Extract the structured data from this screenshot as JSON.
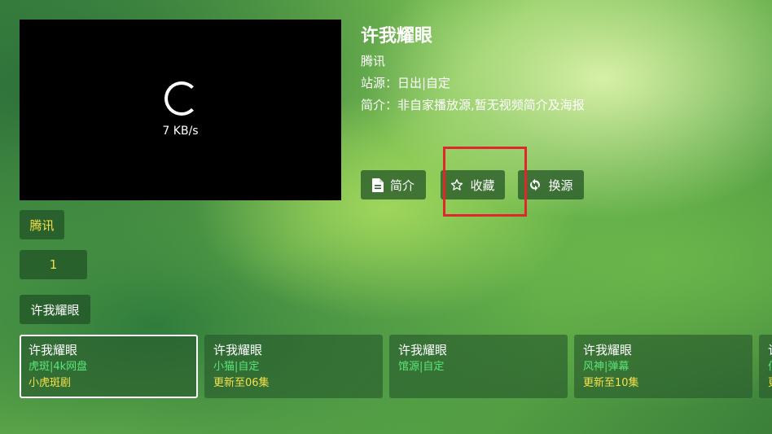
{
  "player": {
    "speed": "7 KB/s"
  },
  "info": {
    "title": "许我耀眼",
    "provider": "腾讯",
    "site": "站源：日出|自定",
    "intro": "简介：非自家播放源,暂无视频简介及海报"
  },
  "actions": {
    "intro_label": "简介",
    "fav_label": "收藏",
    "switch_label": "换源"
  },
  "left": {
    "source_tab": "腾讯",
    "episode": "1",
    "search_name": "许我耀眼"
  },
  "cards": [
    {
      "title": "许我耀眼",
      "source": "虎斑|4k网盘",
      "update": "小虎斑剧"
    },
    {
      "title": "许我耀眼",
      "source": "小猫|自定",
      "update": "更新至06集"
    },
    {
      "title": "许我耀眼",
      "source": "馆源|自定",
      "update": ""
    },
    {
      "title": "许我耀眼",
      "source": "风神|弹幕",
      "update": "更新至10集"
    },
    {
      "title": "许",
      "source": "佰",
      "update": "更"
    }
  ],
  "colors": {
    "highlight_box": "#e0282c",
    "source_text": "#5ce67a",
    "update_text": "#f5e04a"
  }
}
